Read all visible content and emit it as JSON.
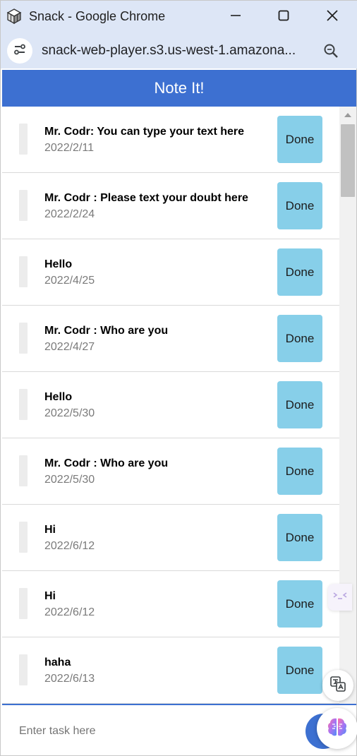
{
  "window": {
    "title": "Snack - Google Chrome",
    "url": "snack-web-player.s3.us-west-1.amazona..."
  },
  "app": {
    "title": "Note It!"
  },
  "tasks": [
    {
      "text": "Mr. Codr: You can type your text here",
      "date": "2022/2/11",
      "button": "Done"
    },
    {
      "text": "Mr. Codr : Please text your doubt here",
      "date": "2022/2/24",
      "button": "Done"
    },
    {
      "text": "Hello",
      "date": "2022/4/25",
      "button": "Done"
    },
    {
      "text": "Mr. Codr : Who are you",
      "date": "2022/4/27",
      "button": "Done"
    },
    {
      "text": "Hello",
      "date": "2022/5/30",
      "button": "Done"
    },
    {
      "text": "Mr. Codr : Who are you",
      "date": "2022/5/30",
      "button": "Done"
    },
    {
      "text": "Hi",
      "date": "2022/6/12",
      "button": "Done"
    },
    {
      "text": "Hi",
      "date": "2022/6/12",
      "button": "Done"
    },
    {
      "text": "haha",
      "date": "2022/6/13",
      "button": "Done"
    }
  ],
  "input": {
    "placeholder": "Enter task here"
  },
  "colors": {
    "header": "#3d70d1",
    "done_button": "#87cfe9",
    "placeholder": "#d0211a",
    "chrome_bar": "#dde6f6"
  },
  "icons": {
    "app": "snack-cube-icon",
    "minimize": "minimize-icon",
    "maximize": "maximize-icon",
    "close": "close-icon",
    "site_info": "tune-icon",
    "zoom": "zoom-icon",
    "side_tab": "sidebar-peek-icon",
    "translate": "translate-icon",
    "brain": "brain-icon"
  }
}
